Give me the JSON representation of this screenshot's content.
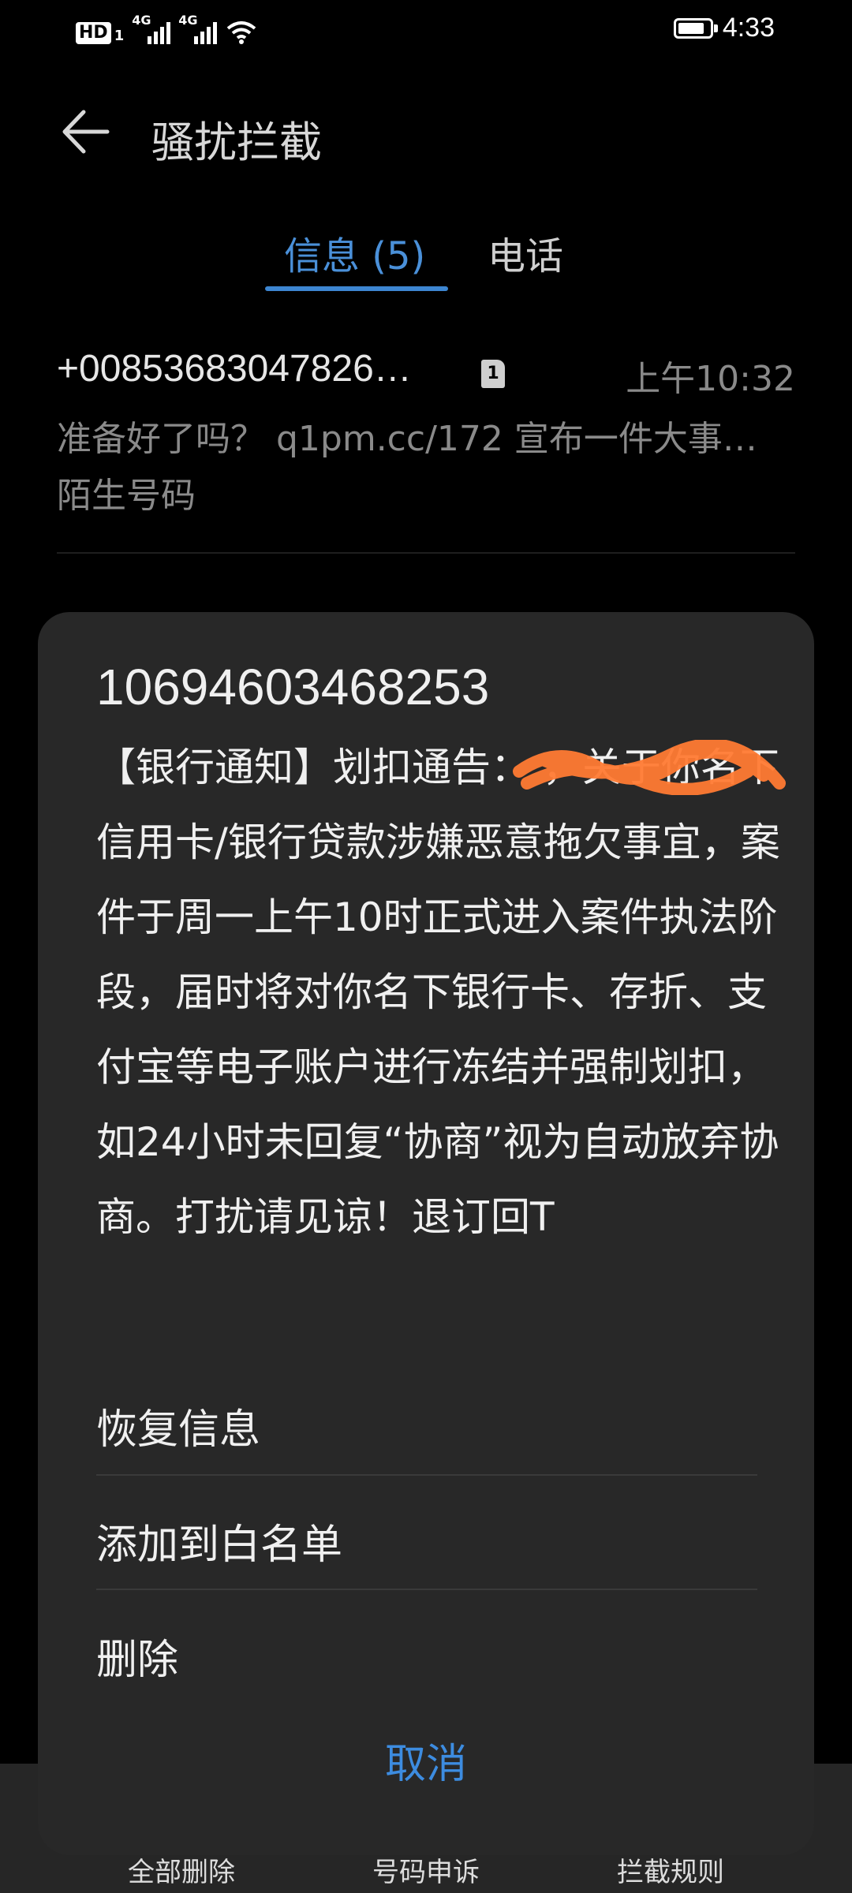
{
  "status_bar": {
    "hd": "HD",
    "sim1": "1",
    "net1": "4G",
    "net2": "4G",
    "time": "4:33",
    "battery_level": 0.85
  },
  "app_bar": {
    "title": "骚扰拦截"
  },
  "tabs": [
    {
      "label": "信息 (5)",
      "selected": true
    },
    {
      "label": "电话",
      "selected": false
    }
  ],
  "messages": [
    {
      "sender": "+00853683047826…",
      "sim": "1",
      "time": "上午10:32",
      "preview": "准备好了吗？ q1pm.cc/172  宣布一件大事…",
      "note": "陌生号码"
    }
  ],
  "bottom_nav": [
    "全部删除",
    "号码申诉",
    "拦截规则"
  ],
  "dialog": {
    "title": "10694603468253",
    "body": "【银行通知】划扣通告：                ，关于你名下信用卡/银行贷款涉嫌恶意拖欠事宜，案件于周一上午10时正式进入案件执法阶段，届时将对你名下银行卡、存折、支付宝等电子账户进行冻结并强制划扣，如24小时未回复“协商”视为自动放弃协商。打扰请见谅！退订回T",
    "options": [
      "恢复信息",
      "添加到白名单",
      "删除"
    ],
    "cancel": "取消"
  }
}
